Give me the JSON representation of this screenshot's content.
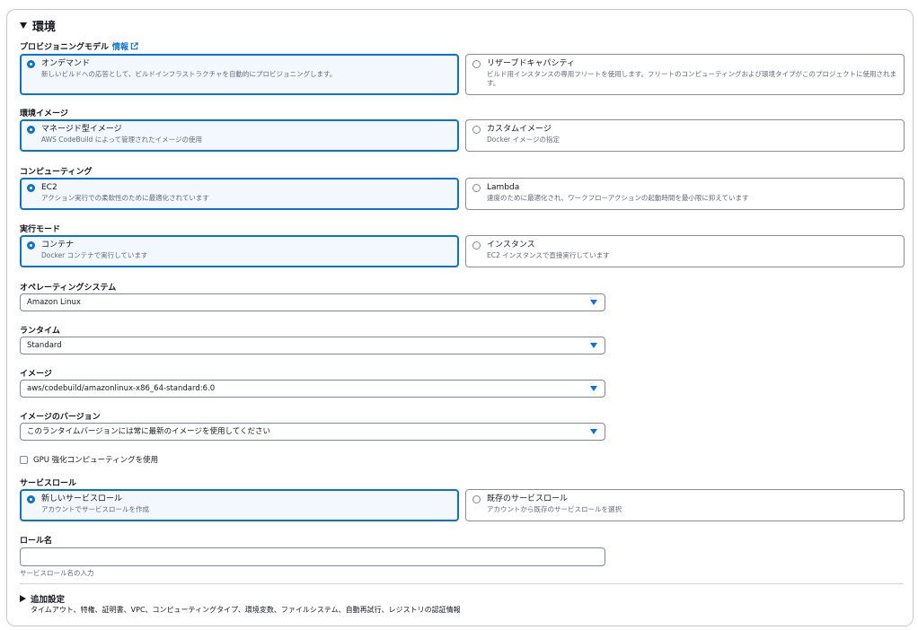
{
  "section": {
    "title": "環境"
  },
  "provisioning": {
    "label": "プロビジョニングモデル",
    "info": "情報",
    "options": [
      {
        "title": "オンデマンド",
        "desc": "新しいビルドへの応答として、ビルドインフラストラクチャを自動的にプロビジョニングします。"
      },
      {
        "title": "リザーブドキャパシティ",
        "desc": "ビルド用インスタンスの専用フリートを使用します。フリートのコンピューティングおよび環境タイプがこのプロジェクトに使用されます。"
      }
    ]
  },
  "env_image": {
    "label": "環境イメージ",
    "options": [
      {
        "title": "マネージド型イメージ",
        "desc": "AWS CodeBuild によって管理されたイメージの使用"
      },
      {
        "title": "カスタムイメージ",
        "desc": "Docker イメージの指定"
      }
    ]
  },
  "compute": {
    "label": "コンピューティング",
    "options": [
      {
        "title": "EC2",
        "desc": "アクション実行での柔軟性のために最適化されています"
      },
      {
        "title": "Lambda",
        "desc": "速度のために最適化され、ワークフローアクションの起動時間を最小限に抑えています"
      }
    ]
  },
  "run_mode": {
    "label": "実行モード",
    "options": [
      {
        "title": "コンテナ",
        "desc": "Docker コンテナで実行しています"
      },
      {
        "title": "インスタンス",
        "desc": "EC2 インスタンスで直接実行しています"
      }
    ]
  },
  "os": {
    "label": "オペレーティングシステム",
    "value": "Amazon Linux"
  },
  "runtime": {
    "label": "ランタイム",
    "value": "Standard"
  },
  "image": {
    "label": "イメージ",
    "value": "aws/codebuild/amazonlinux-x86_64-standard:6.0"
  },
  "image_version": {
    "label": "イメージのバージョン",
    "value": "このランタイムバージョンには常に最新のイメージを使用してください"
  },
  "gpu": {
    "label": "GPU 強化コンピューティングを使用"
  },
  "service_role": {
    "label": "サービスロール",
    "options": [
      {
        "title": "新しいサービスロール",
        "desc": "アカウントでサービスロールを作成"
      },
      {
        "title": "既存のサービスロール",
        "desc": "アカウントから既存のサービスロールを選択"
      }
    ]
  },
  "role_name": {
    "label": "ロール名",
    "value": "",
    "hint": "サービスロール名の入力"
  },
  "advanced": {
    "title": "追加設定",
    "desc": "タイムアウト、特権、証明書、VPC、コンピューティングタイプ、環境変数、ファイルシステム、自動再試行、レジストリの認証情報"
  },
  "colors": {
    "accent": "#0972d3",
    "selected_bg": "#f2f8fd",
    "border": "#8c8c94"
  }
}
